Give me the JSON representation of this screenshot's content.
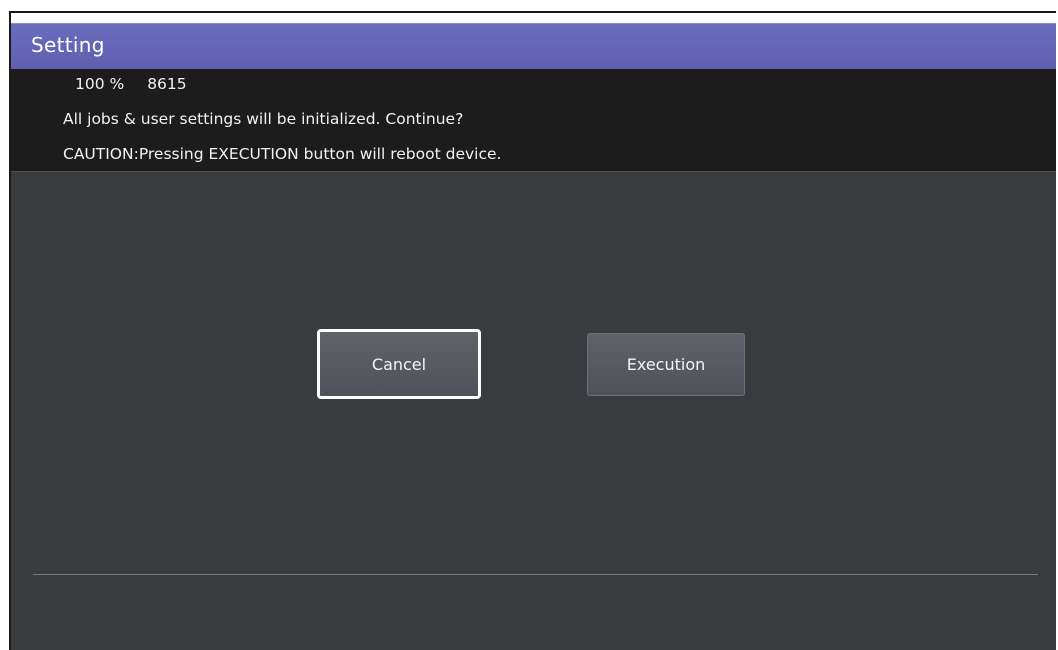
{
  "window": {
    "title": "Setting"
  },
  "message": {
    "percent": "100 %",
    "code": "8615",
    "line1": "All jobs & user settings will be initialized. Continue?",
    "line2": "CAUTION:Pressing EXECUTION button will reboot device."
  },
  "actions": {
    "cancel_label": "Cancel",
    "execution_label": "Execution"
  },
  "colors": {
    "title_bar": "#6465b6",
    "message_bg": "#1c1c1d",
    "body_bg": "#3a3b3f",
    "button_bg": "#5a5c64",
    "focus_border": "#ffffff"
  }
}
